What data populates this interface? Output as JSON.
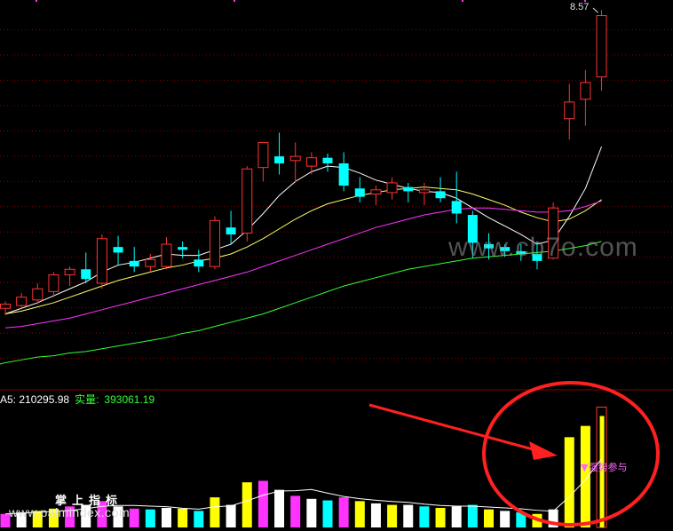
{
  "peak_label": "8.57",
  "watermark_bg": "www.cb7o.com",
  "watermark_cn": "掌上指标",
  "watermark_url": "www.palmindex.com",
  "signal_label": "▼强势参与",
  "volume_legend": {
    "ma5_label": "A5: 210295.98",
    "actual_label": "实量:",
    "actual_value": "393061.19"
  },
  "colors": {
    "up": "#ff3333",
    "down": "#00ffff",
    "ma5": "#ffffff",
    "ma10": "#ffff66",
    "ma20": "#ff33ff",
    "ma60": "#33ff33",
    "grid": "#8b0000",
    "annotation": "#ff2020",
    "vol_yellow": "#ffff00",
    "vol_magenta": "#ff33ff",
    "vol_white": "#ffffff",
    "vol_cyan": "#00ffff"
  },
  "chart_data": [
    {
      "type": "candlestick",
      "x": [
        "1",
        "2",
        "3",
        "4",
        "5",
        "6",
        "7",
        "8",
        "9",
        "10",
        "11",
        "12",
        "13",
        "14",
        "15",
        "16",
        "17",
        "18",
        "19",
        "20",
        "21",
        "22",
        "23",
        "24",
        "25",
        "26",
        "27",
        "28",
        "29",
        "30",
        "31",
        "32",
        "33",
        "34",
        "35",
        "36",
        "37",
        "38"
      ],
      "ohlc": [
        [
          6.44,
          6.49,
          6.39,
          6.47
        ],
        [
          6.46,
          6.55,
          6.44,
          6.52
        ],
        [
          6.5,
          6.62,
          6.47,
          6.58
        ],
        [
          6.56,
          6.7,
          6.52,
          6.68
        ],
        [
          6.68,
          6.74,
          6.6,
          6.72
        ],
        [
          6.72,
          6.84,
          6.62,
          6.65
        ],
        [
          6.62,
          6.97,
          6.58,
          6.94
        ],
        [
          6.88,
          6.96,
          6.75,
          6.84
        ],
        [
          6.78,
          6.88,
          6.7,
          6.74
        ],
        [
          6.74,
          6.83,
          6.7,
          6.79
        ],
        [
          6.74,
          6.95,
          6.72,
          6.9
        ],
        [
          6.88,
          6.92,
          6.8,
          6.86
        ],
        [
          6.79,
          6.86,
          6.7,
          6.74
        ],
        [
          6.74,
          7.1,
          6.72,
          7.07
        ],
        [
          7.02,
          7.14,
          6.9,
          6.97
        ],
        [
          6.98,
          7.46,
          6.92,
          7.44
        ],
        [
          7.45,
          7.5,
          7.35,
          7.63
        ],
        [
          7.53,
          7.7,
          7.4,
          7.48
        ],
        [
          7.5,
          7.63,
          7.34,
          7.53
        ],
        [
          7.46,
          7.56,
          7.4,
          7.52
        ],
        [
          7.52,
          7.55,
          7.42,
          7.48
        ],
        [
          7.48,
          7.56,
          7.28,
          7.32
        ],
        [
          7.3,
          7.38,
          7.2,
          7.24
        ],
        [
          7.26,
          7.32,
          7.18,
          7.29
        ],
        [
          7.27,
          7.38,
          7.22,
          7.34
        ],
        [
          7.31,
          7.34,
          7.2,
          7.28
        ],
        [
          7.27,
          7.34,
          7.18,
          7.29
        ],
        [
          7.28,
          7.38,
          7.2,
          7.23
        ],
        [
          7.21,
          7.42,
          7.05,
          7.12
        ],
        [
          7.11,
          7.14,
          6.8,
          6.91
        ],
        [
          6.9,
          6.98,
          6.79,
          6.87
        ],
        [
          6.88,
          6.9,
          6.81,
          6.85
        ],
        [
          6.85,
          6.9,
          6.78,
          6.83
        ],
        [
          6.83,
          6.92,
          6.72,
          6.78
        ],
        [
          6.8,
          7.2,
          6.79,
          7.16
        ],
        [
          7.8,
          8.05,
          7.65,
          7.92
        ],
        [
          7.94,
          8.15,
          7.75,
          8.06
        ],
        [
          8.1,
          8.58,
          8.0,
          8.54
        ]
      ],
      "ma_series": [
        {
          "name": "MA5",
          "values": [
            6.4,
            6.44,
            6.48,
            6.53,
            6.58,
            6.63,
            6.7,
            6.75,
            6.77,
            6.8,
            6.83,
            6.82,
            6.82,
            6.86,
            6.9,
            7.0,
            7.12,
            7.25,
            7.35,
            7.42,
            7.46,
            7.45,
            7.41,
            7.36,
            7.33,
            7.3,
            7.28,
            7.27,
            7.23,
            7.16,
            7.09,
            7.03,
            6.97,
            6.9,
            6.93,
            7.1,
            7.3,
            7.6
          ]
        },
        {
          "name": "MA10",
          "values": [
            6.4,
            6.42,
            6.45,
            6.48,
            6.52,
            6.56,
            6.6,
            6.64,
            6.67,
            6.7,
            6.73,
            6.75,
            6.78,
            6.8,
            6.83,
            6.88,
            6.94,
            7.01,
            7.08,
            7.14,
            7.19,
            7.22,
            7.25,
            7.27,
            7.29,
            7.3,
            7.31,
            7.3,
            7.29,
            7.26,
            7.22,
            7.18,
            7.13,
            7.09,
            7.06,
            7.08,
            7.14,
            7.22
          ]
        },
        {
          "name": "MA20",
          "values": [
            6.3,
            6.31,
            6.33,
            6.35,
            6.37,
            6.4,
            6.43,
            6.46,
            6.49,
            6.52,
            6.55,
            6.58,
            6.61,
            6.64,
            6.67,
            6.7,
            6.74,
            6.78,
            6.82,
            6.86,
            6.9,
            6.94,
            6.98,
            7.02,
            7.05,
            7.08,
            7.11,
            7.13,
            7.15,
            7.16,
            7.16,
            7.15,
            7.14,
            7.13,
            7.13,
            7.14,
            7.17,
            7.21
          ]
        },
        {
          "name": "MA60",
          "values": [
            6.05,
            6.07,
            6.09,
            6.1,
            6.12,
            6.13,
            6.15,
            6.17,
            6.19,
            6.21,
            6.23,
            6.26,
            6.28,
            6.31,
            6.34,
            6.37,
            6.4,
            6.44,
            6.48,
            6.52,
            6.56,
            6.6,
            6.63,
            6.66,
            6.69,
            6.72,
            6.74,
            6.76,
            6.78,
            6.8,
            6.81,
            6.82,
            6.83,
            6.84,
            6.85,
            6.87,
            6.89,
            6.92
          ]
        }
      ],
      "ylim": [
        5.9,
        8.62
      ],
      "grid": true
    },
    {
      "type": "bar",
      "series_name": "volume",
      "values": [
        18,
        20,
        22,
        25,
        28,
        30,
        35,
        28,
        25,
        24,
        26,
        25,
        22,
        40,
        30,
        60,
        62,
        50,
        42,
        38,
        36,
        40,
        35,
        32,
        30,
        30,
        28,
        26,
        28,
        30,
        24,
        22,
        20,
        18,
        24,
        120,
        135,
        160
      ],
      "bar_colors": [
        "vol_magenta",
        "vol_white",
        "vol_yellow",
        "vol_yellow",
        "vol_magenta",
        "vol_white",
        "vol_magenta",
        "vol_white",
        "vol_magenta",
        "vol_cyan",
        "vol_white",
        "vol_yellow",
        "vol_cyan",
        "vol_yellow",
        "vol_white",
        "vol_yellow",
        "vol_magenta",
        "vol_white",
        "vol_magenta",
        "vol_white",
        "vol_cyan",
        "vol_magenta",
        "vol_yellow",
        "vol_white",
        "vol_yellow",
        "vol_white",
        "vol_cyan",
        "vol_yellow",
        "vol_white",
        "vol_cyan",
        "vol_yellow",
        "vol_white",
        "vol_cyan",
        "vol_yellow",
        "vol_white",
        "vol_yellow",
        "vol_yellow",
        "vol_yellow"
      ],
      "ylim": [
        0,
        170
      ]
    }
  ]
}
